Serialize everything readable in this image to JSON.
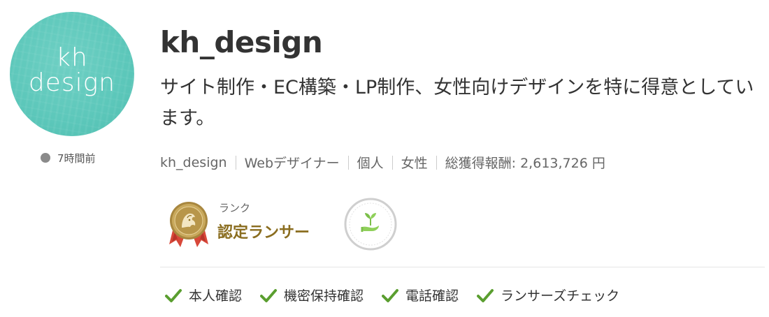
{
  "avatar": {
    "logo_line1": "kh",
    "logo_line2": "design",
    "bg_color": "#5cc7ba"
  },
  "status": {
    "last_login": "7時間前",
    "dot_color": "#8a8a8a"
  },
  "profile": {
    "username": "kh_design",
    "catchphrase": "サイト制作・EC構築・LP制作、女性向けデザインを特に得意としています。",
    "meta": [
      "kh_design",
      "Webデザイナー",
      "個人",
      "女性",
      "総獲得報酬: 2,613,726 円"
    ]
  },
  "rank": {
    "label": "ランク",
    "name": "認定ランサー",
    "medal_icon": "certified-medal-icon",
    "plant_icon": "sprout-hand-icon",
    "name_color": "#8a6d1f"
  },
  "verifications": {
    "check_color": "#5a9e2f",
    "items": [
      "本人確認",
      "機密保持確認",
      "電話確認",
      "ランサーズチェック"
    ]
  }
}
